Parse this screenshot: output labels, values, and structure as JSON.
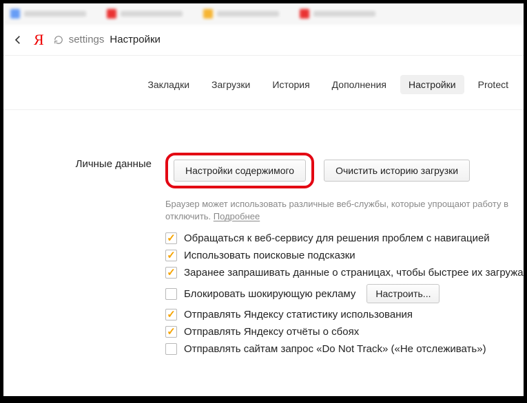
{
  "address": {
    "path": "settings",
    "title": "Настройки"
  },
  "nav": {
    "items": [
      {
        "label": "Закладки"
      },
      {
        "label": "Загрузки"
      },
      {
        "label": "История"
      },
      {
        "label": "Дополнения"
      },
      {
        "label": "Настройки"
      },
      {
        "label": "Protect"
      }
    ],
    "active_index": 4
  },
  "section": {
    "heading": "Личные данные",
    "btn_content": "Настройки содержимого",
    "btn_clear": "Очистить историю загрузки",
    "desc_line": "Браузер может использовать различные веб-службы, которые упрощают работу в отключить.",
    "desc_link": "Подробнее",
    "configure_btn": "Настроить...",
    "checks": [
      {
        "checked": true,
        "label": "Обращаться к веб-сервису для решения проблем с навигацией"
      },
      {
        "checked": true,
        "label": "Использовать поисковые подсказки"
      },
      {
        "checked": true,
        "label": "Заранее запрашивать данные о страницах, чтобы быстрее их загружа"
      },
      {
        "checked": false,
        "label": "Блокировать шокирующую рекламу"
      },
      {
        "checked": true,
        "label": "Отправлять Яндексу статистику использования"
      },
      {
        "checked": true,
        "label": "Отправлять Яндексу отчёты о сбоях"
      },
      {
        "checked": false,
        "label": "Отправлять сайтам запрос «Do Not Track» («Не отслеживать»)"
      }
    ]
  }
}
